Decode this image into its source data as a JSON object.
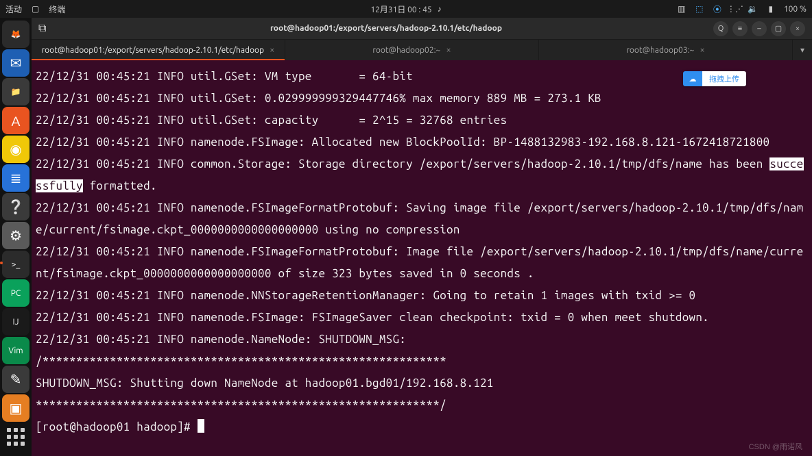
{
  "topbar": {
    "activities": "活动",
    "app": "终端",
    "datetime": "12月31日 00 : 45",
    "battery": "100 %"
  },
  "titlebar": {
    "newtab": "⧉",
    "title": "root@hadoop01:/export/servers/hadoop-2.10.1/etc/hadoop"
  },
  "tabs": [
    {
      "label": "root@hadoop01:/export/servers/hadoop-2.10.1/etc/hadoop",
      "active": true
    },
    {
      "label": "root@hadoop02:~",
      "active": false
    },
    {
      "label": "root@hadoop03:~",
      "active": false
    }
  ],
  "terminal": {
    "lines": [
      "22/12/31 00:45:21 INFO util.GSet: VM type       = 64-bit",
      "22/12/31 00:45:21 INFO util.GSet: 0.029999999329447746% max memory 889 MB = 273.1 KB",
      "22/12/31 00:45:21 INFO util.GSet: capacity      = 2^15 = 32768 entries",
      "22/12/31 00:45:21 INFO namenode.FSImage: Allocated new BlockPoolId: BP-1488132983-192.168.8.121-1672418721800",
      "22/12/31 00:45:21 INFO common.Storage: Storage directory /export/servers/hadoop-2.10.1/tmp/dfs/name has been |successfully| formatted.",
      "22/12/31 00:45:21 INFO namenode.FSImageFormatProtobuf: Saving image file /export/servers/hadoop-2.10.1/tmp/dfs/name/current/fsimage.ckpt_0000000000000000000 using no compression",
      "22/12/31 00:45:21 INFO namenode.FSImageFormatProtobuf: Image file /export/servers/hadoop-2.10.1/tmp/dfs/name/current/fsimage.ckpt_0000000000000000000 of size 323 bytes saved in 0 seconds .",
      "22/12/31 00:45:21 INFO namenode.NNStorageRetentionManager: Going to retain 1 images with txid >= 0",
      "22/12/31 00:45:21 INFO namenode.FSImage: FSImageSaver clean checkpoint: txid = 0 when meet shutdown.",
      "22/12/31 00:45:21 INFO namenode.NameNode: SHUTDOWN_MSG:",
      "/************************************************************",
      "SHUTDOWN_MSG: Shutting down NameNode at hadoop01.bgd01/192.168.8.121",
      "************************************************************/"
    ],
    "prompt": "[root@hadoop01 hadoop]# "
  },
  "upload": {
    "text": "拖拽上传"
  },
  "watermark": "CSDN @雨诺风",
  "dock": [
    {
      "name": "firefox-icon",
      "glyph": "🦊",
      "bg": "#2b2b2b"
    },
    {
      "name": "thunderbird-icon",
      "glyph": "✉",
      "bg": "#1e5fb3"
    },
    {
      "name": "files-icon",
      "glyph": "📁",
      "bg": "#3a3a3a"
    },
    {
      "name": "software-icon",
      "glyph": "A",
      "bg": "#e95420"
    },
    {
      "name": "rhythmbox-icon",
      "glyph": "◉",
      "bg": "#f0c808"
    },
    {
      "name": "libreoffice-icon",
      "glyph": "≣",
      "bg": "#2772d8"
    },
    {
      "name": "help-icon",
      "glyph": "❔",
      "bg": "#3a3a3a"
    },
    {
      "name": "settings-icon",
      "glyph": "⚙",
      "bg": "#5a5a5a"
    },
    {
      "name": "terminal-icon",
      "glyph": ">_",
      "bg": "#2b2b2b",
      "active": true
    },
    {
      "name": "pycharm-icon",
      "glyph": "PC",
      "bg": "#0aa15b"
    },
    {
      "name": "intellij-icon",
      "glyph": "IJ",
      "bg": "#1a1a1a"
    },
    {
      "name": "vim-icon",
      "glyph": "Vim",
      "bg": "#0a8a4a"
    },
    {
      "name": "gedit-icon",
      "glyph": "✎",
      "bg": "#3a3a3a"
    },
    {
      "name": "vm-icon",
      "glyph": "▣",
      "bg": "#e67e22"
    }
  ]
}
